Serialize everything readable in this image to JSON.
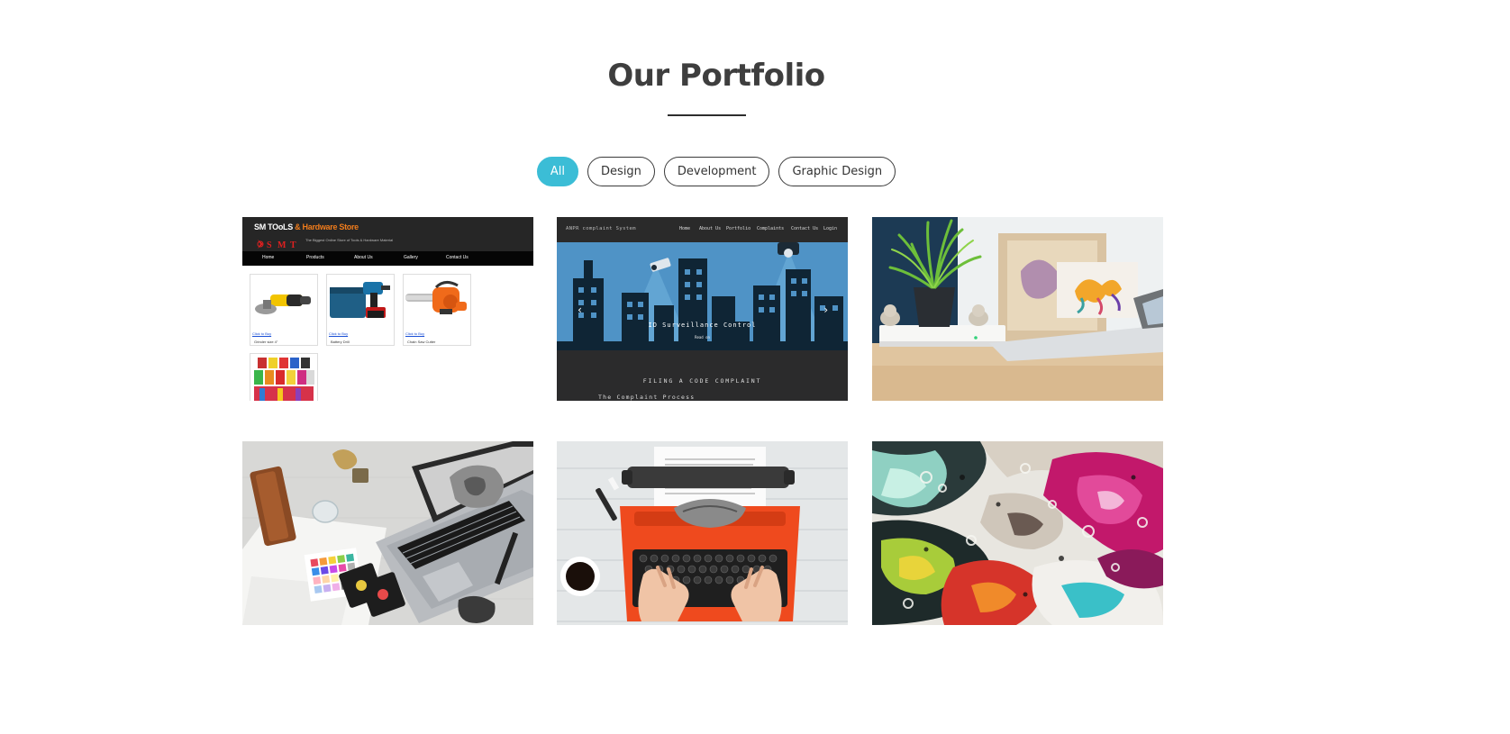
{
  "section": {
    "title": "Our Portfolio"
  },
  "filters": [
    {
      "label": "All",
      "active": true
    },
    {
      "label": "Design",
      "active": false
    },
    {
      "label": "Development",
      "active": false
    },
    {
      "label": "Graphic Design",
      "active": false
    }
  ],
  "tiles": {
    "t1": {
      "store_name": "SM TOoLS",
      "store_name_accent": "& Hardware Store",
      "tagline": "The Biggest Online Store of Tools & Hardware Material",
      "nav": [
        "Home",
        "Products",
        "About Us",
        "Gallery",
        "Contact Us"
      ],
      "products": [
        {
          "buy": "Click to Buy",
          "name": "Grinder size 4\""
        },
        {
          "buy": "Click to Buy",
          "name": "Battery Drill"
        },
        {
          "buy": "Click to Buy",
          "name": "Chain Saw Cutter"
        }
      ]
    },
    "t2": {
      "brand": "ANPR complaint System",
      "menu": [
        "Home",
        "About Us",
        "Portfolio",
        "Complaints",
        "Contact Us",
        "Login"
      ],
      "hero_text": "ID Surveillance Control",
      "hero_small": "Read on",
      "section_heading": "FILING A CODE COMPLAINT",
      "section_sub": "The Complaint Process"
    }
  },
  "colors": {
    "accent": "#3bbdd6",
    "heading": "#3e3e3e"
  }
}
